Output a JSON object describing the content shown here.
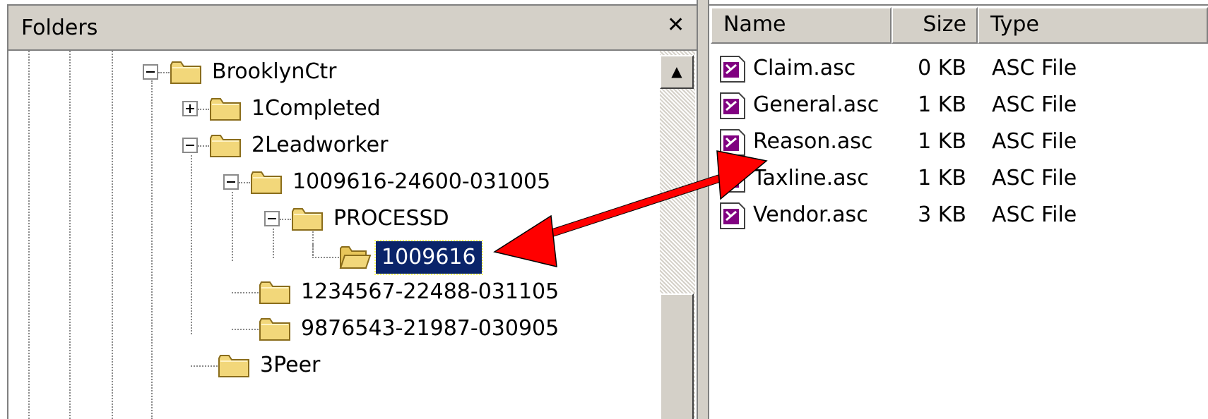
{
  "folders_pane": {
    "title": "Folders",
    "close_glyph": "✕",
    "tree": [
      {
        "label": "BrooklynCtr",
        "expander": "minus"
      },
      {
        "label": "1Completed",
        "expander": "plus"
      },
      {
        "label": "2Leadworker",
        "expander": "minus"
      },
      {
        "label": "1009616-24600-031005",
        "expander": "minus"
      },
      {
        "label": "PROCESSD",
        "expander": "minus"
      },
      {
        "label": "1009616",
        "expander": "none",
        "selected": true
      },
      {
        "label": "1234567-22488-031105",
        "expander": "none"
      },
      {
        "label": "9876543-21987-030905",
        "expander": "none"
      },
      {
        "label": "3Peer",
        "expander": "none"
      }
    ],
    "scroll_up_glyph": "▲"
  },
  "file_list": {
    "columns": {
      "name": "Name",
      "size": "Size",
      "type": "Type"
    },
    "files": [
      {
        "name": "Claim.asc",
        "size": "0 KB",
        "type": "ASC File"
      },
      {
        "name": "General.asc",
        "size": "1 KB",
        "type": "ASC File"
      },
      {
        "name": "Reason.asc",
        "size": "1 KB",
        "type": "ASC File"
      },
      {
        "name": "Taxline.asc",
        "size": "1 KB",
        "type": "ASC File"
      },
      {
        "name": "Vendor.asc",
        "size": "3 KB",
        "type": "ASC File"
      }
    ]
  },
  "colors": {
    "selection": "#0a246a",
    "chrome": "#d4d0c8",
    "folder": "#f2d77a",
    "arrow": "#ff0000",
    "file_icon": "#800080"
  }
}
